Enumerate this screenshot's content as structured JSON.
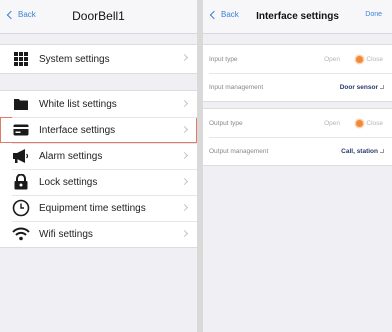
{
  "left": {
    "back_label": "Back",
    "title": "DoorBell1",
    "system_settings": {
      "label": "System settings",
      "icon": "grid-icon"
    },
    "menu": [
      {
        "key": "whitelist",
        "label": "White list settings",
        "icon": "folder-icon"
      },
      {
        "key": "interface",
        "label": "Interface settings",
        "icon": "card-icon"
      },
      {
        "key": "alarm",
        "label": "Alarm settings",
        "icon": "megaphone-icon"
      },
      {
        "key": "lock",
        "label": "Lock settings",
        "icon": "lock-icon"
      },
      {
        "key": "time",
        "label": "Equipment time settings",
        "icon": "clock-icon"
      },
      {
        "key": "wifi",
        "label": "Wifi settings",
        "icon": "wifi-icon"
      }
    ],
    "highlighted": "Interface settings"
  },
  "right": {
    "back_label": "Back",
    "title": "Interface settings",
    "done_label": "Done",
    "input_type": {
      "label": "Input type",
      "open": "Open",
      "close": "Close",
      "selected": "Close"
    },
    "input_management": {
      "label": "Input management",
      "value": "Door sensor"
    },
    "output_type": {
      "label": "Output type",
      "open": "Open",
      "close": "Close",
      "selected": "Close"
    },
    "output_management": {
      "label": "Output management",
      "value": "Call, station"
    }
  },
  "colors": {
    "accent": "#3b82d6",
    "radio_selected": "#f08a3a",
    "highlight_border": "#e07a6a",
    "background": "#efeff4"
  }
}
